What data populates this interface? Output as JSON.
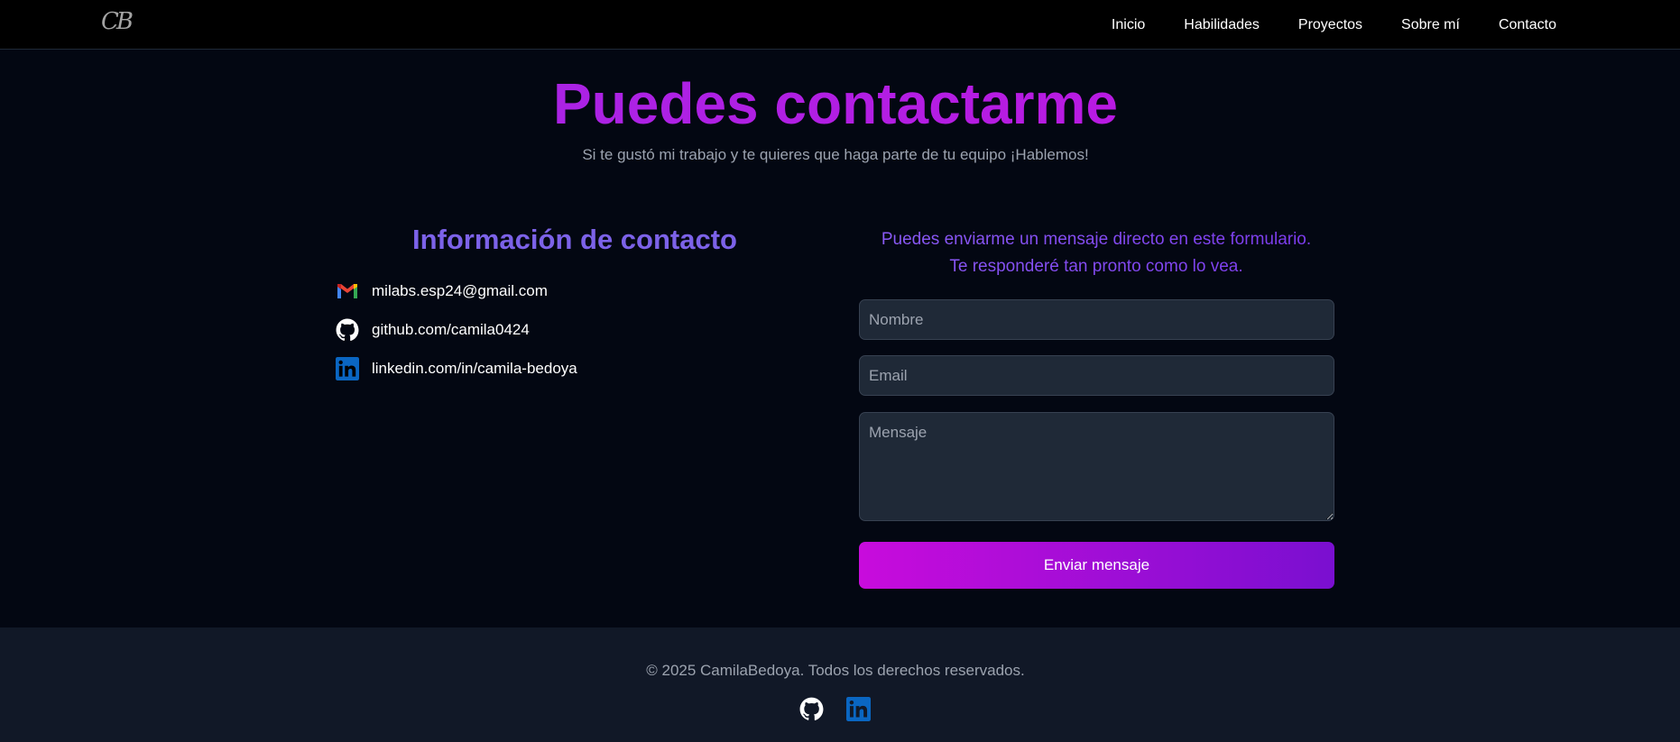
{
  "navbar": {
    "logo": "CB",
    "links": [
      "Inicio",
      "Habilidades",
      "Proyectos",
      "Sobre mí",
      "Contacto"
    ]
  },
  "hero": {
    "title": "Puedes contactarme",
    "subtitle": "Si te gustó mi trabajo y te quieres que haga parte de tu equipo ¡Hablemos!"
  },
  "contact_info": {
    "title": "Información de contacto",
    "items": [
      {
        "icon": "gmail-icon",
        "text": "milabs.esp24@gmail.com"
      },
      {
        "icon": "github-icon",
        "text": "github.com/camila0424"
      },
      {
        "icon": "linkedin-icon",
        "text": "linkedin.com/in/camila-bedoya"
      }
    ]
  },
  "form": {
    "intro_line1": "Puedes enviarme un mensaje directo en este formulario.",
    "intro_line2": "Te responderé tan pronto como lo vea.",
    "name_placeholder": "Nombre",
    "email_placeholder": "Email",
    "message_placeholder": "Mensaje",
    "submit_label": "Enviar mensaje"
  },
  "footer": {
    "copyright": "© 2025 CamilaBedoya. Todos los derechos reservados.",
    "socials": [
      "github-icon",
      "linkedin-icon"
    ]
  },
  "colors": {
    "background": "#030712",
    "navbar": "#000000",
    "accent_purple": "#c612e0",
    "accent_violet": "#7c62e8",
    "field_bg": "#1f2937",
    "footer_bg": "#111827"
  }
}
